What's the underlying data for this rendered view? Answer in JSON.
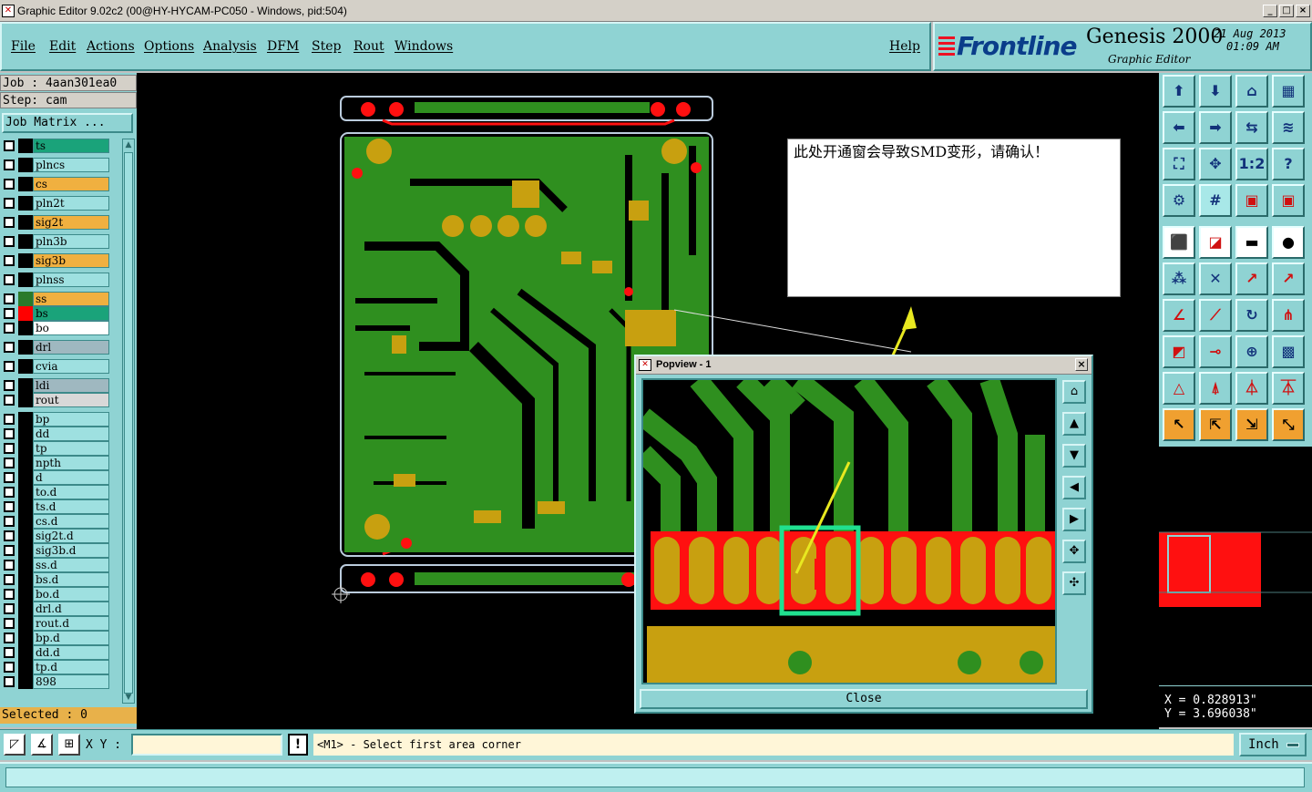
{
  "window": {
    "title": "Graphic Editor 9.02c2 (00@HY-HYCAM-PC050 - Windows, pid:504)",
    "icon": "x-icon",
    "buttons": [
      "_",
      "□",
      "×"
    ]
  },
  "menu": [
    "File",
    "Edit",
    "Actions",
    "Options",
    "Analysis",
    "DFM",
    "Step",
    "Rout",
    "Windows"
  ],
  "help": "Help",
  "brand": {
    "logo": "Frontline",
    "product": "Genesis 2000",
    "subtitle": "Graphic Editor",
    "date": "21 Aug 2013",
    "time": "01:09 AM"
  },
  "job": {
    "line": "Job : 4aan301ea0",
    "step": "Step: cam",
    "matrix_button": "Job Matrix ..."
  },
  "layers": [
    {
      "name": "ts",
      "color": "#1aa37a",
      "swatch": "#000"
    },
    {
      "name": "plncs",
      "color": "#9ee0e0",
      "swatch": "#000"
    },
    {
      "name": "cs",
      "color": "#f0b040",
      "swatch": "#000"
    },
    {
      "name": "pln2t",
      "color": "#9ee0e0",
      "swatch": "#000"
    },
    {
      "name": "sig2t",
      "color": "#f0b040",
      "swatch": "#000"
    },
    {
      "name": "pln3b",
      "color": "#9ee0e0",
      "swatch": "#000"
    },
    {
      "name": "sig3b",
      "color": "#f0b040",
      "swatch": "#000"
    },
    {
      "name": "plnss",
      "color": "#9ee0e0",
      "swatch": "#000"
    },
    {
      "name": "ss",
      "color": "#f0b040",
      "swatch": "#2a7a2a"
    },
    {
      "name": "bs",
      "color": "#1aa37a",
      "swatch": "#ff0000"
    },
    {
      "name": "bo",
      "color": "#ffffff",
      "swatch": "#000"
    },
    {
      "name": "drl",
      "color": "#9fb8c0",
      "swatch": "#000"
    },
    {
      "name": "cvia",
      "color": "#9ee0e0",
      "swatch": "#000"
    },
    {
      "name": "ldi",
      "color": "#9fb8c0",
      "swatch": "#000"
    },
    {
      "name": "rout",
      "color": "#d8d8d8",
      "swatch": "#000"
    },
    {
      "name": "bp",
      "color": "#9ee0e0",
      "swatch": "#000"
    },
    {
      "name": "dd",
      "color": "#9ee0e0",
      "swatch": "#000"
    },
    {
      "name": "tp",
      "color": "#9ee0e0",
      "swatch": "#000"
    },
    {
      "name": "npth",
      "color": "#9ee0e0",
      "swatch": "#000"
    },
    {
      "name": "d",
      "color": "#9ee0e0",
      "swatch": "#000"
    },
    {
      "name": "to.d",
      "color": "#9ee0e0",
      "swatch": "#000"
    },
    {
      "name": "ts.d",
      "color": "#9ee0e0",
      "swatch": "#000"
    },
    {
      "name": "cs.d",
      "color": "#9ee0e0",
      "swatch": "#000"
    },
    {
      "name": "sig2t.d",
      "color": "#9ee0e0",
      "swatch": "#000"
    },
    {
      "name": "sig3b.d",
      "color": "#9ee0e0",
      "swatch": "#000"
    },
    {
      "name": "ss.d",
      "color": "#9ee0e0",
      "swatch": "#000"
    },
    {
      "name": "bs.d",
      "color": "#9ee0e0",
      "swatch": "#000"
    },
    {
      "name": "bo.d",
      "color": "#9ee0e0",
      "swatch": "#000"
    },
    {
      "name": "drl.d",
      "color": "#9ee0e0",
      "swatch": "#000"
    },
    {
      "name": "rout.d",
      "color": "#9ee0e0",
      "swatch": "#000"
    },
    {
      "name": "bp.d",
      "color": "#9ee0e0",
      "swatch": "#000"
    },
    {
      "name": "dd.d",
      "color": "#9ee0e0",
      "swatch": "#000"
    },
    {
      "name": "tp.d",
      "color": "#9ee0e0",
      "swatch": "#000"
    },
    {
      "name": "898",
      "color": "#9ee0e0",
      "swatch": "#000"
    }
  ],
  "selected": "Selected : 0",
  "note": "此处开通窗会导致SMD变形，请确认！",
  "popview": {
    "title": "Popview - 1",
    "close": "Close"
  },
  "coords": {
    "x": "X = 0.828913\"",
    "y": "Y = 3.696038\""
  },
  "bottom": {
    "xy_label": "X Y :",
    "xy_value": "",
    "prompt": "<M1> - Select first area corner",
    "unit": "Inch"
  },
  "colors": {
    "panel": "#8fd3d3",
    "copper": "#2f8f1f",
    "pad": "#c8a010",
    "mask": "#ff0000"
  }
}
